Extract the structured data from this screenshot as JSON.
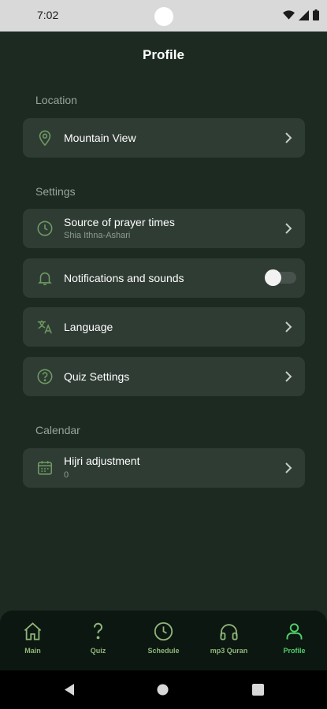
{
  "status_bar": {
    "time": "7:02"
  },
  "page": {
    "title": "Profile"
  },
  "location": {
    "section_label": "Location",
    "item": {
      "title": "Mountain View",
      "icon": "location-pin-icon"
    }
  },
  "settings": {
    "section_label": "Settings",
    "items": [
      {
        "title": "Source of prayer times",
        "subtitle": "Shia Ithna-Ashari",
        "icon": "clock-icon"
      },
      {
        "title": "Notifications and sounds",
        "icon": "bell-icon",
        "toggle_on": false
      },
      {
        "title": "Language",
        "icon": "translate-icon"
      },
      {
        "title": "Quiz Settings",
        "icon": "question-circle-icon"
      }
    ]
  },
  "calendar": {
    "section_label": "Calendar",
    "item": {
      "title": "Hijri adjustment",
      "subtitle": "0",
      "icon": "calendar-icon"
    }
  },
  "bottom_nav": {
    "items": [
      {
        "label": "Main",
        "icon": "home-icon"
      },
      {
        "label": "Quiz",
        "icon": "question-mark-icon"
      },
      {
        "label": "Schedule",
        "icon": "clock-icon"
      },
      {
        "label": "mp3 Quran",
        "icon": "headphones-icon"
      },
      {
        "label": "Profile",
        "icon": "person-icon",
        "active": true
      }
    ]
  },
  "colors": {
    "background": "#1c2a22",
    "card": "#2f3c34",
    "accent_active": "#4fd06a",
    "nav_inactive": "#8fb77a",
    "icon_green": "#6f9b62"
  }
}
